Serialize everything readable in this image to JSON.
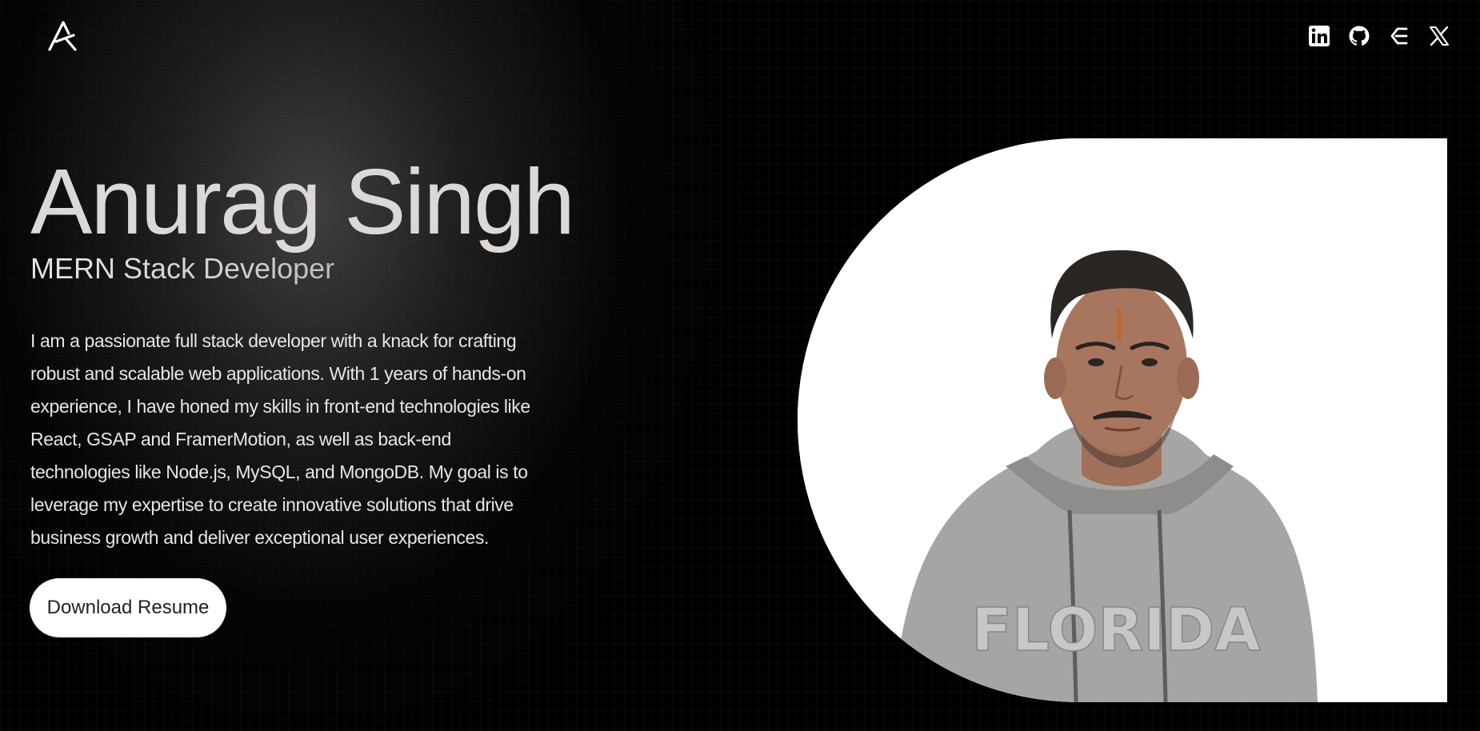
{
  "brand": {
    "logo_icon": "stylized-a-logo-icon"
  },
  "socials": [
    {
      "name": "LinkedIn",
      "icon": "linkedin-icon"
    },
    {
      "name": "GitHub",
      "icon": "github-icon"
    },
    {
      "name": "Blog",
      "icon": "blog-e-icon"
    },
    {
      "name": "X",
      "icon": "x-icon"
    }
  ],
  "hero": {
    "name": "Anurag Singh",
    "role": "MERN Stack Developer",
    "bio": "I am a passionate full stack developer with a knack for crafting robust and scalable web applications. With 1 years of hands-on experience, I have honed my skills in front-end technologies like React, GSAP and FramerMotion, as well as back-end technologies like Node.js, MySQL, and MongoDB. My goal is to leverage my expertise to create innovative solutions that drive business growth and deliver exceptional user experiences.",
    "cta_label": "Download Resume"
  },
  "photo": {
    "hoodie_text": "FLORIDA"
  },
  "colors": {
    "background": "#000000",
    "name_text": "#dcd8d6",
    "button_bg": "#ffffff",
    "photo_bg": "#ffffff"
  }
}
